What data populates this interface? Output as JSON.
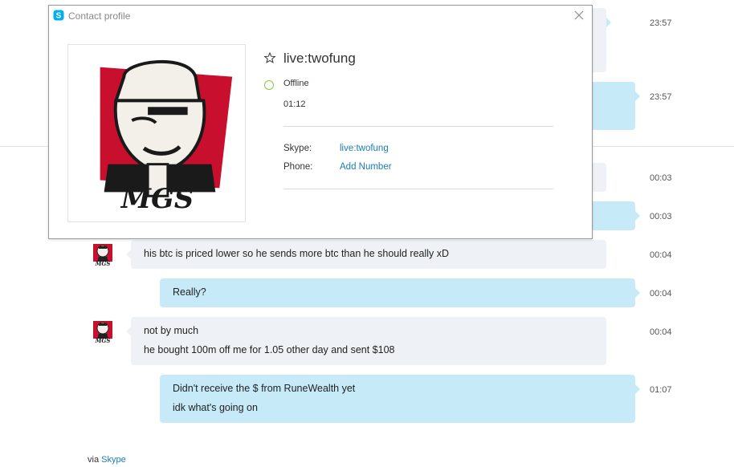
{
  "dialog": {
    "title": "Contact profile",
    "contact_name": "live:twofung",
    "status": "Offline",
    "local_time": "01:12",
    "fields": [
      {
        "label": "Skype:",
        "value": "live:twofung"
      },
      {
        "label": "Phone:",
        "value": "Add Number"
      }
    ],
    "avatar_text": "MGS"
  },
  "messages": [
    {
      "dir": "out",
      "time": "23:57",
      "lines": []
    },
    {
      "dir": "out",
      "time": "23:57",
      "lines": []
    },
    {
      "dir": "out",
      "time": "00:03",
      "lines": []
    },
    {
      "dir": "out",
      "time": "00:03",
      "lines": []
    },
    {
      "dir": "in",
      "time": "00:04",
      "lines": [
        "his btc is priced lower so he sends more btc than he should really xD"
      ]
    },
    {
      "dir": "out",
      "time": "00:04",
      "lines": [
        "Really?"
      ]
    },
    {
      "dir": "in",
      "time": "00:04",
      "lines": [
        "not by much",
        "he bought 100m off me for 1.05 other day and sent $108"
      ]
    },
    {
      "dir": "out",
      "time": "01:07",
      "lines": [
        "Didn't receive the $ from RuneWealth yet",
        "idk what's going on"
      ]
    }
  ],
  "footer": {
    "via": "via",
    "link": "Skype"
  },
  "colors": {
    "incoming": "#eef2f6",
    "outgoing": "#c7eaf9",
    "link": "#1a7db5",
    "online_ring": "#8cc63e",
    "logo_red": "#c8102e"
  }
}
